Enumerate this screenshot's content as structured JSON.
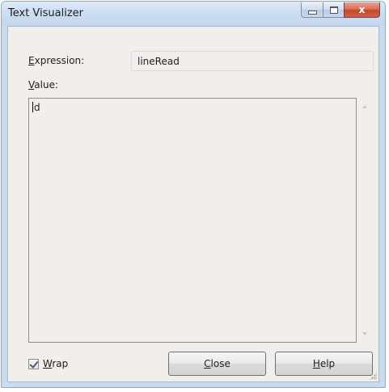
{
  "window": {
    "title": "Text Visualizer"
  },
  "caption_buttons": {
    "close_glyph": "x"
  },
  "expression": {
    "label_accel": "E",
    "label_rest": "xpression:",
    "value": "lineRead"
  },
  "value": {
    "label_accel": "V",
    "label_rest": "alue:",
    "text": "d"
  },
  "wrap": {
    "label_accel": "W",
    "label_rest": "rap",
    "checked": true
  },
  "buttons": {
    "close_accel": "C",
    "close_rest": "lose",
    "help_accel": "H",
    "help_rest": "elp"
  },
  "colors": {
    "frame": "#c9dbef",
    "client": "#f1eeec",
    "close_button": "#c2462c"
  },
  "icons": {
    "minimize": "minimize-icon",
    "maximize": "maximize-icon",
    "close": "close-icon",
    "scroll_up": "scroll-up-arrow-icon",
    "scroll_down": "scroll-down-arrow-icon",
    "checkmark": "checkmark-icon",
    "resize_grip": "resize-grip-icon"
  }
}
